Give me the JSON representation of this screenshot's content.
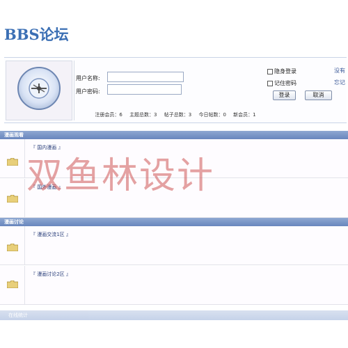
{
  "app": {
    "logo": "BBS论坛"
  },
  "login": {
    "username_label": "用户名称:",
    "password_label": "用户密码:",
    "username_value": "",
    "password_value": "",
    "hide_login_label": "隐身登录",
    "remember_label": "记住密码",
    "login_button": "登录",
    "cancel_button": "取消",
    "side_link_1": "没有",
    "side_link_2": "忘记"
  },
  "stats": {
    "registered": "注册会员：6",
    "topics": "主题总数：3",
    "posts": "帖子总数：3",
    "today": "今日帖数：0",
    "newest": "新会员：1"
  },
  "categories": [
    {
      "title": "漫画观看",
      "forums": [
        {
          "name": "『 国内漫画 』"
        },
        {
          "name": "『 国外漫画 』"
        }
      ]
    },
    {
      "title": "漫画讨论",
      "forums": [
        {
          "name": "『 漫画交流1区 』"
        },
        {
          "name": "『 漫画讨论2区 』"
        }
      ]
    }
  ],
  "footer": {
    "label": "在线统计"
  },
  "watermark": "双鱼林设计",
  "colors": {
    "header_blue": "#6886bd",
    "logo_blue": "#3b6fb4",
    "watermark_red": "#cd5555"
  }
}
